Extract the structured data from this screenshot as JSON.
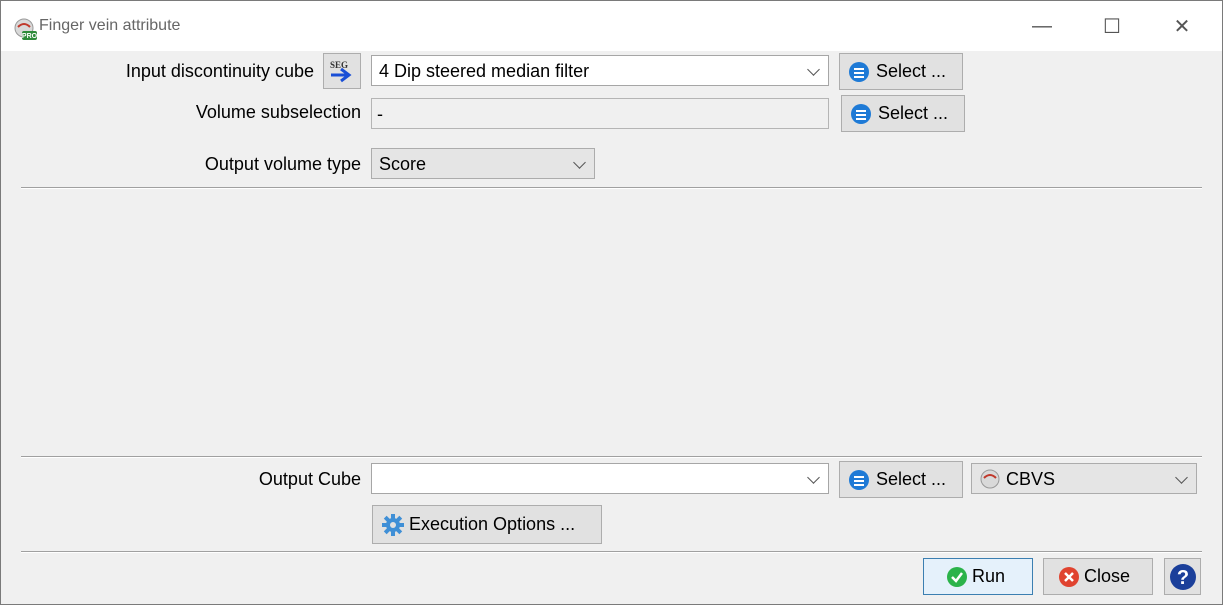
{
  "window": {
    "title": "Finger vein attribute",
    "minimize_symbol": "—",
    "maximize_symbol": "☐",
    "close_symbol": "✕",
    "app_icon": "pro-app-icon"
  },
  "input": {
    "label": "Input discontinuity cube",
    "seg_icon_text": "SEG",
    "selected": "4 Dip steered median filter",
    "select_label": "Select ..."
  },
  "volume": {
    "label": "Volume subselection",
    "value": "-",
    "select_label": "Select ..."
  },
  "output_type": {
    "label": "Output volume type",
    "selected": "Score"
  },
  "output": {
    "label": "Output Cube",
    "value": "",
    "select_label": "Select ...",
    "format": "CBVS",
    "execution_label": "Execution Options ..."
  },
  "footer": {
    "run_label": "Run",
    "close_label": "Close",
    "help_symbol": "?"
  },
  "colors": {
    "accent_blue": "#1e7ad6",
    "run_green": "#2bb34a",
    "close_red": "#e0432f",
    "help_blue": "#1b3f9a"
  }
}
